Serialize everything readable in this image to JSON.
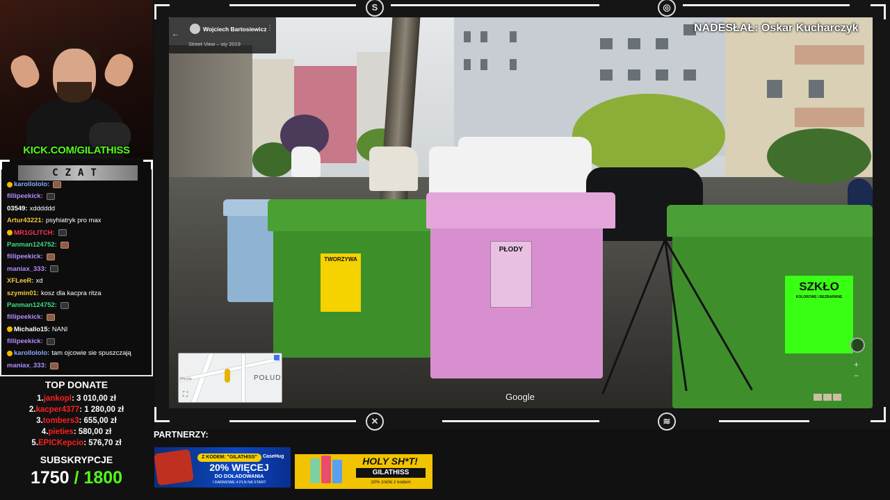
{
  "stream": {
    "channel_link": "KICK.COM/GILATHISS",
    "credit": "NADESŁAŁ: Oskar Kucharczyk"
  },
  "chat": {
    "title": "CZAT",
    "messages": [
      {
        "user": "karollololo:",
        "text": "",
        "user_color": "#8ea7ff",
        "badge": true,
        "emote": true
      },
      {
        "user": "fillipeekick:",
        "text": "",
        "user_color": "#b38cff",
        "badge": false,
        "emote": true
      },
      {
        "user": "03549:",
        "text": "xdddddd",
        "user_color": "#ffffff",
        "badge": false,
        "emote": false
      },
      {
        "user": "Artur43221:",
        "text": "psyhiatryk pro max",
        "user_color": "#f5c842",
        "badge": false,
        "emote": false
      },
      {
        "user": "MR1GLITCH:",
        "text": "",
        "user_color": "#ff3355",
        "badge": true,
        "emote": true
      },
      {
        "user": "Panman124752:",
        "text": "",
        "user_color": "#3ddc84",
        "badge": false,
        "emote": true
      },
      {
        "user": "fillipeekick:",
        "text": "",
        "user_color": "#b38cff",
        "badge": false,
        "emote": true
      },
      {
        "user": "maniax_333:",
        "text": "",
        "user_color": "#b38cff",
        "badge": false,
        "emote": true
      },
      {
        "user": "XFLeeR:",
        "text": "xd",
        "user_color": "#f5c842",
        "badge": false,
        "emote": false
      },
      {
        "user": "szymin01:",
        "text": "kosz dla kacpra ritza",
        "user_color": "#f5c842",
        "badge": false,
        "emote": false
      },
      {
        "user": "Panman124752:",
        "text": "",
        "user_color": "#3ddc84",
        "badge": false,
        "emote": true
      },
      {
        "user": "fillipeekick:",
        "text": "",
        "user_color": "#b38cff",
        "badge": false,
        "emote": true
      },
      {
        "user": "Michallo15:",
        "text": "NANI",
        "user_color": "#ffffff",
        "badge": true,
        "emote": false
      },
      {
        "user": "fillipeekick:",
        "text": "",
        "user_color": "#b38cff",
        "badge": false,
        "emote": true
      },
      {
        "user": "karollololo:",
        "text": "tam ojcowie sie spuszczają",
        "user_color": "#8ea7ff",
        "badge": true,
        "emote": false
      },
      {
        "user": "maniax_333:",
        "text": "",
        "user_color": "#b38cff",
        "badge": false,
        "emote": true
      }
    ]
  },
  "top_donate": {
    "title": "TOP DONATE",
    "entries": [
      {
        "rank": "1.",
        "name": "jankopl",
        "amount": "3 010,00 zł"
      },
      {
        "rank": "2.",
        "name": "kacper4377",
        "amount": "1 280,00 zł"
      },
      {
        "rank": "3.",
        "name": "tombers3",
        "amount": "655,00 zł"
      },
      {
        "rank": "4.",
        "name": "pieties",
        "amount": "580,00 zł"
      },
      {
        "rank": "5.",
        "name": "EPICKepcio",
        "amount": "576,70 zł"
      }
    ]
  },
  "subs": {
    "title": "SUBSKRYPCJE",
    "current": "1750",
    "goal": "/ 1800"
  },
  "streetview": {
    "author": "Wojciech Bartosiewicz",
    "date": "Street View – sty 2019",
    "google": "Google",
    "minimap_label": "POŁUD",
    "minimap_street": "Wasola"
  },
  "bins": {
    "plastic_label": "TWORZYWA",
    "bio_label": "PŁODY",
    "glass_label": "SZKŁO",
    "glass_sub": "KOLOROWE I BEZBARWNE"
  },
  "partners": {
    "title": "PARTNERZY:",
    "banner1": {
      "code": "Z KODEM: \"GILATHISS\"",
      "brand": "CaseHug",
      "headline": "20% WIĘCEJ",
      "sub": "DO DOŁADOWANIA",
      "sub2": "I DARMOWE 4 PLN NA START"
    },
    "banner2": {
      "headline": "HOLY SH*T!",
      "code": "GILATHISS",
      "discount": "10% zniżki z kodem"
    }
  },
  "colors": {
    "accent_green": "#53fc18",
    "donor_red": "#ff1f1f",
    "bin_green": "#3d8f2a",
    "bin_pink": "#d88fcf",
    "bin_blue": "#8fb3d2"
  }
}
